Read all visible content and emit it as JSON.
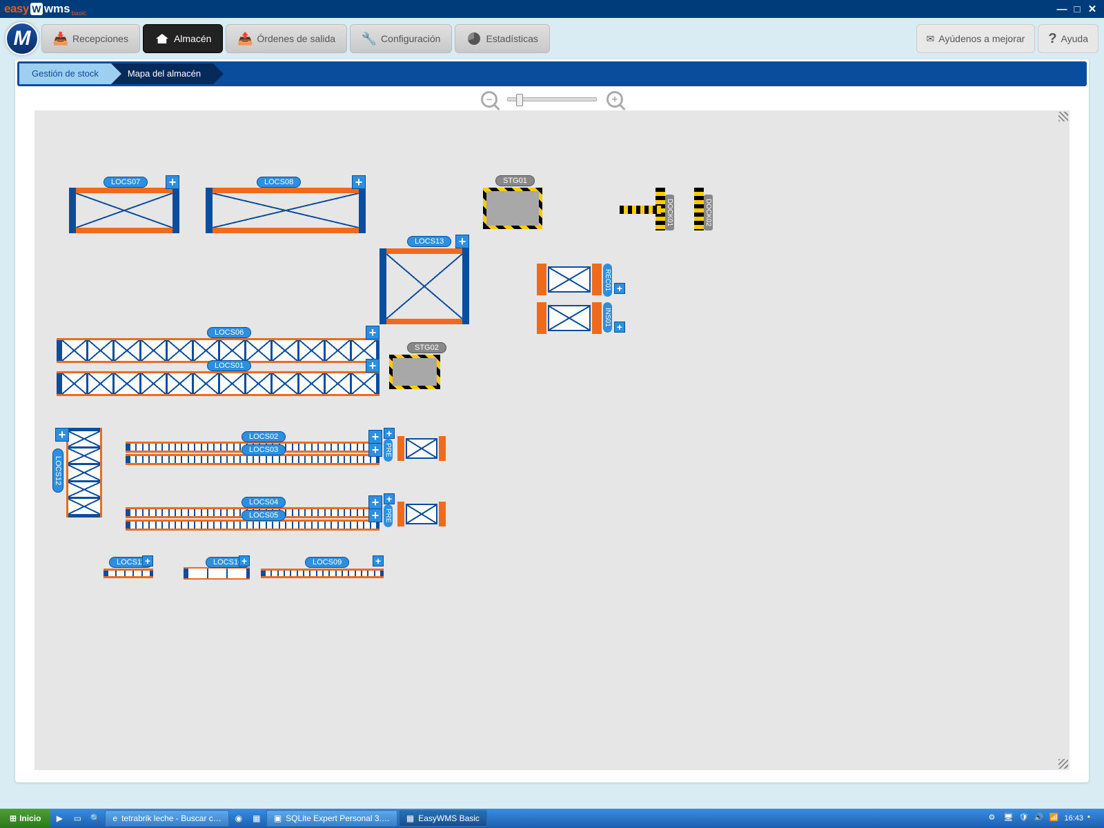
{
  "app": {
    "logo_easy": "easy",
    "logo_wms": "wms",
    "logo_sub": "basic"
  },
  "win": {
    "min": "—",
    "max": "□",
    "close": "✕"
  },
  "toolbar": {
    "recepciones": "Recepciones",
    "almacen": "Almacén",
    "ordenes": "Órdenes de salida",
    "config": "Configuración",
    "stats": "Estadísticas",
    "improve": "Ayúdenos a mejorar",
    "help": "Ayuda"
  },
  "breadcrumb": {
    "a": "Gestión de stock",
    "b": "Mapa del almacén"
  },
  "zoom": {
    "out": "–",
    "in": "+"
  },
  "zones": {
    "locs07": "LOCS07",
    "locs08": "LOCS08",
    "locs13": "LOCS13",
    "locs06": "LOCS06",
    "locs01": "LOCS01",
    "locs02": "LOCS02",
    "locs03": "LOCS03",
    "locs04": "LOCS04",
    "locs05": "LOCS05",
    "locs11": "LOCS11",
    "locs10": "LOCS10",
    "locs09": "LOCS09",
    "locs12": "LOCS12",
    "stg01": "STG01",
    "stg02": "STG02",
    "dock01": "DOCK01",
    "dock02": "DOCK02",
    "rec01": "REC01",
    "ins01": "INS01",
    "pre1": "PRE",
    "pre2": "PRE"
  },
  "taskbar": {
    "start": "Inicio",
    "t1": "tetrabrik leche - Buscar c…",
    "t2": "SQLite Expert Personal 3.…",
    "t3": "EasyWMS Basic",
    "clock": "16:43"
  }
}
